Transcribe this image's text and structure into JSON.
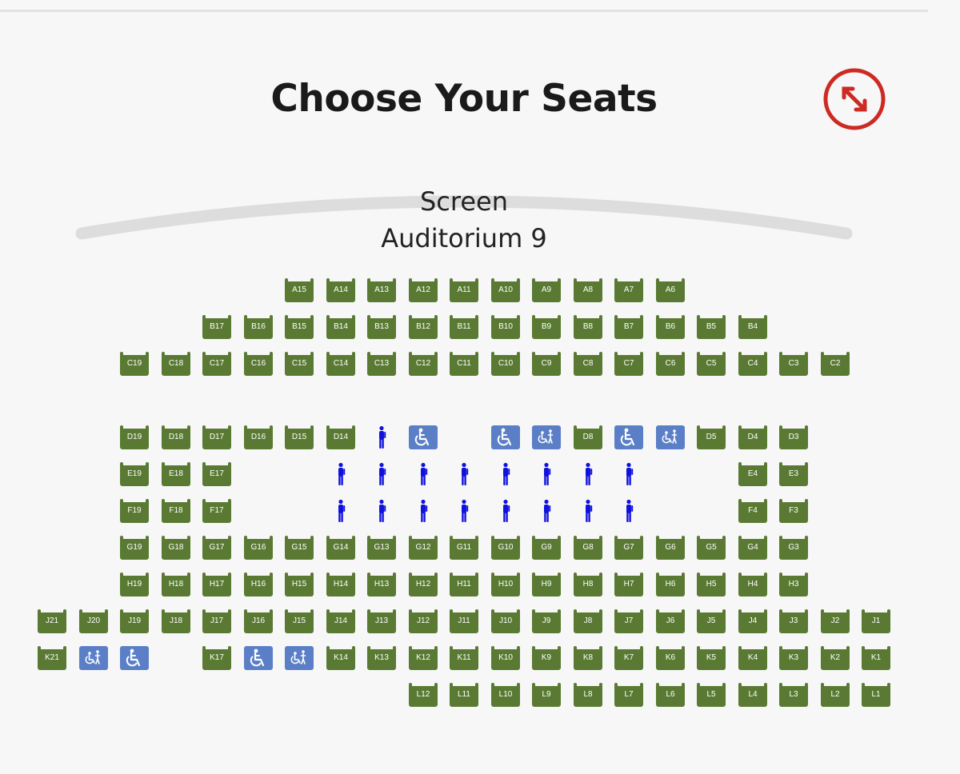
{
  "page": {
    "title": "Choose Your Seats",
    "screen_label": "Screen",
    "auditorium": "Auditorium 9",
    "expand_icon": "expand-arrows-icon",
    "accent_color": "#cc2a22"
  },
  "legend_colors": {
    "available": "#5a7a33",
    "wheelchair": "#5b7fc7",
    "occupied": "#1111dd"
  },
  "seat_rows": [
    {
      "row": "A",
      "seats": [
        {
          "id": "A15",
          "type": "seat"
        },
        {
          "id": "A14",
          "type": "seat"
        },
        {
          "id": "A13",
          "type": "seat"
        },
        {
          "id": "A12",
          "type": "seat"
        },
        {
          "id": "A11",
          "type": "seat"
        },
        {
          "id": "A10",
          "type": "seat"
        },
        {
          "id": "A9",
          "type": "seat"
        },
        {
          "id": "A8",
          "type": "seat"
        },
        {
          "id": "A7",
          "type": "seat"
        },
        {
          "id": "A6",
          "type": "seat"
        }
      ]
    },
    {
      "row": "B",
      "seats": [
        {
          "id": "B17",
          "type": "seat"
        },
        {
          "id": "B16",
          "type": "seat"
        },
        {
          "id": "B15",
          "type": "seat"
        },
        {
          "id": "B14",
          "type": "seat"
        },
        {
          "id": "B13",
          "type": "seat"
        },
        {
          "id": "B12",
          "type": "seat"
        },
        {
          "id": "B11",
          "type": "seat"
        },
        {
          "id": "B10",
          "type": "seat"
        },
        {
          "id": "B9",
          "type": "seat"
        },
        {
          "id": "B8",
          "type": "seat"
        },
        {
          "id": "B7",
          "type": "seat"
        },
        {
          "id": "B6",
          "type": "seat"
        },
        {
          "id": "B5",
          "type": "seat"
        },
        {
          "id": "B4",
          "type": "seat"
        }
      ]
    },
    {
      "row": "C",
      "seats": [
        {
          "id": "C19",
          "type": "seat"
        },
        {
          "id": "C18",
          "type": "seat"
        },
        {
          "id": "C17",
          "type": "seat"
        },
        {
          "id": "C16",
          "type": "seat"
        },
        {
          "id": "C15",
          "type": "seat"
        },
        {
          "id": "C14",
          "type": "seat"
        },
        {
          "id": "C13",
          "type": "seat"
        },
        {
          "id": "C12",
          "type": "seat"
        },
        {
          "id": "C11",
          "type": "seat"
        },
        {
          "id": "C10",
          "type": "seat"
        },
        {
          "id": "C9",
          "type": "seat"
        },
        {
          "id": "C8",
          "type": "seat"
        },
        {
          "id": "C7",
          "type": "seat"
        },
        {
          "id": "C6",
          "type": "seat"
        },
        {
          "id": "C5",
          "type": "seat"
        },
        {
          "id": "C4",
          "type": "seat"
        },
        {
          "id": "C3",
          "type": "seat"
        },
        {
          "id": "C2",
          "type": "seat"
        }
      ]
    },
    {
      "row": "D",
      "seats": [
        {
          "id": "D19",
          "type": "seat"
        },
        {
          "id": "D18",
          "type": "seat"
        },
        {
          "id": "D17",
          "type": "seat"
        },
        {
          "id": "D16",
          "type": "seat"
        },
        {
          "id": "D15",
          "type": "seat"
        },
        {
          "id": "D14",
          "type": "seat"
        },
        {
          "id": "",
          "type": "occupied"
        },
        {
          "id": "",
          "type": "wheelchair"
        },
        {
          "id": "",
          "type": "gap"
        },
        {
          "id": "",
          "type": "wheelchair"
        },
        {
          "id": "",
          "type": "companion"
        },
        {
          "id": "D8",
          "type": "seat"
        },
        {
          "id": "",
          "type": "wheelchair"
        },
        {
          "id": "",
          "type": "companion"
        },
        {
          "id": "D5",
          "type": "seat"
        },
        {
          "id": "D4",
          "type": "seat"
        },
        {
          "id": "D3",
          "type": "seat"
        }
      ]
    },
    {
      "row": "E",
      "seats": [
        {
          "id": "E19",
          "type": "seat"
        },
        {
          "id": "E18",
          "type": "seat"
        },
        {
          "id": "E17",
          "type": "seat"
        },
        {
          "id": "",
          "type": "gap"
        },
        {
          "id": "",
          "type": "gap"
        },
        {
          "id": "",
          "type": "occupied"
        },
        {
          "id": "",
          "type": "occupied"
        },
        {
          "id": "",
          "type": "occupied"
        },
        {
          "id": "",
          "type": "occupied"
        },
        {
          "id": "",
          "type": "occupied"
        },
        {
          "id": "",
          "type": "occupied"
        },
        {
          "id": "",
          "type": "occupied"
        },
        {
          "id": "",
          "type": "occupied"
        },
        {
          "id": "",
          "type": "gap"
        },
        {
          "id": "",
          "type": "gap"
        },
        {
          "id": "E4",
          "type": "seat"
        },
        {
          "id": "E3",
          "type": "seat"
        }
      ]
    },
    {
      "row": "F",
      "seats": [
        {
          "id": "F19",
          "type": "seat"
        },
        {
          "id": "F18",
          "type": "seat"
        },
        {
          "id": "F17",
          "type": "seat"
        },
        {
          "id": "",
          "type": "gap"
        },
        {
          "id": "",
          "type": "gap"
        },
        {
          "id": "",
          "type": "occupied"
        },
        {
          "id": "",
          "type": "occupied"
        },
        {
          "id": "",
          "type": "occupied"
        },
        {
          "id": "",
          "type": "occupied"
        },
        {
          "id": "",
          "type": "occupied"
        },
        {
          "id": "",
          "type": "occupied"
        },
        {
          "id": "",
          "type": "occupied"
        },
        {
          "id": "",
          "type": "occupied"
        },
        {
          "id": "",
          "type": "gap"
        },
        {
          "id": "",
          "type": "gap"
        },
        {
          "id": "F4",
          "type": "seat"
        },
        {
          "id": "F3",
          "type": "seat"
        }
      ]
    },
    {
      "row": "G",
      "seats": [
        {
          "id": "G19",
          "type": "seat"
        },
        {
          "id": "G18",
          "type": "seat"
        },
        {
          "id": "G17",
          "type": "seat"
        },
        {
          "id": "G16",
          "type": "seat"
        },
        {
          "id": "G15",
          "type": "seat"
        },
        {
          "id": "G14",
          "type": "seat"
        },
        {
          "id": "G13",
          "type": "seat"
        },
        {
          "id": "G12",
          "type": "seat"
        },
        {
          "id": "G11",
          "type": "seat"
        },
        {
          "id": "G10",
          "type": "seat"
        },
        {
          "id": "G9",
          "type": "seat"
        },
        {
          "id": "G8",
          "type": "seat"
        },
        {
          "id": "G7",
          "type": "seat"
        },
        {
          "id": "G6",
          "type": "seat"
        },
        {
          "id": "G5",
          "type": "seat"
        },
        {
          "id": "G4",
          "type": "seat"
        },
        {
          "id": "G3",
          "type": "seat"
        }
      ]
    },
    {
      "row": "H",
      "seats": [
        {
          "id": "H19",
          "type": "seat"
        },
        {
          "id": "H18",
          "type": "seat"
        },
        {
          "id": "H17",
          "type": "seat"
        },
        {
          "id": "H16",
          "type": "seat"
        },
        {
          "id": "H15",
          "type": "seat"
        },
        {
          "id": "H14",
          "type": "seat"
        },
        {
          "id": "H13",
          "type": "seat"
        },
        {
          "id": "H12",
          "type": "seat"
        },
        {
          "id": "H11",
          "type": "seat"
        },
        {
          "id": "H10",
          "type": "seat"
        },
        {
          "id": "H9",
          "type": "seat"
        },
        {
          "id": "H8",
          "type": "seat"
        },
        {
          "id": "H7",
          "type": "seat"
        },
        {
          "id": "H6",
          "type": "seat"
        },
        {
          "id": "H5",
          "type": "seat"
        },
        {
          "id": "H4",
          "type": "seat"
        },
        {
          "id": "H3",
          "type": "seat"
        }
      ]
    },
    {
      "row": "J",
      "seats": [
        {
          "id": "J21",
          "type": "seat"
        },
        {
          "id": "J20",
          "type": "seat"
        },
        {
          "id": "J19",
          "type": "seat"
        },
        {
          "id": "J18",
          "type": "seat"
        },
        {
          "id": "J17",
          "type": "seat"
        },
        {
          "id": "J16",
          "type": "seat"
        },
        {
          "id": "J15",
          "type": "seat"
        },
        {
          "id": "J14",
          "type": "seat"
        },
        {
          "id": "J13",
          "type": "seat"
        },
        {
          "id": "J12",
          "type": "seat"
        },
        {
          "id": "J11",
          "type": "seat"
        },
        {
          "id": "J10",
          "type": "seat"
        },
        {
          "id": "J9",
          "type": "seat"
        },
        {
          "id": "J8",
          "type": "seat"
        },
        {
          "id": "J7",
          "type": "seat"
        },
        {
          "id": "J6",
          "type": "seat"
        },
        {
          "id": "J5",
          "type": "seat"
        },
        {
          "id": "J4",
          "type": "seat"
        },
        {
          "id": "J3",
          "type": "seat"
        },
        {
          "id": "J2",
          "type": "seat"
        },
        {
          "id": "J1",
          "type": "seat"
        }
      ]
    },
    {
      "row": "K",
      "seats": [
        {
          "id": "K21",
          "type": "seat"
        },
        {
          "id": "",
          "type": "companion"
        },
        {
          "id": "",
          "type": "wheelchair"
        },
        {
          "id": "",
          "type": "gap"
        },
        {
          "id": "K17",
          "type": "seat"
        },
        {
          "id": "",
          "type": "wheelchair"
        },
        {
          "id": "",
          "type": "companion"
        },
        {
          "id": "K14",
          "type": "seat"
        },
        {
          "id": "K13",
          "type": "seat"
        },
        {
          "id": "K12",
          "type": "seat"
        },
        {
          "id": "K11",
          "type": "seat"
        },
        {
          "id": "K10",
          "type": "seat"
        },
        {
          "id": "K9",
          "type": "seat"
        },
        {
          "id": "K8",
          "type": "seat"
        },
        {
          "id": "K7",
          "type": "seat"
        },
        {
          "id": "K6",
          "type": "seat"
        },
        {
          "id": "K5",
          "type": "seat"
        },
        {
          "id": "K4",
          "type": "seat"
        },
        {
          "id": "K3",
          "type": "seat"
        },
        {
          "id": "K2",
          "type": "seat"
        },
        {
          "id": "K1",
          "type": "seat"
        }
      ]
    },
    {
      "row": "L",
      "seats": [
        {
          "id": "L12",
          "type": "seat"
        },
        {
          "id": "L11",
          "type": "seat"
        },
        {
          "id": "L10",
          "type": "seat"
        },
        {
          "id": "L9",
          "type": "seat"
        },
        {
          "id": "L8",
          "type": "seat"
        },
        {
          "id": "L7",
          "type": "seat"
        },
        {
          "id": "L6",
          "type": "seat"
        },
        {
          "id": "L5",
          "type": "seat"
        },
        {
          "id": "L4",
          "type": "seat"
        },
        {
          "id": "L3",
          "type": "seat"
        },
        {
          "id": "L2",
          "type": "seat"
        },
        {
          "id": "L1",
          "type": "seat"
        }
      ]
    }
  ]
}
